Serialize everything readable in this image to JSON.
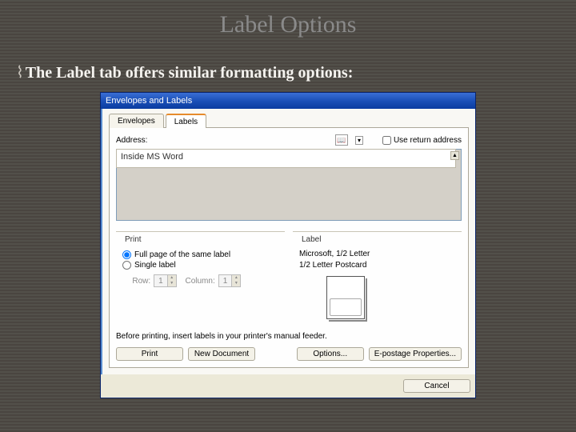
{
  "slide": {
    "title": "Label Options",
    "bullet_glyph": "⌇",
    "body": "The Label tab offers similar formatting options:"
  },
  "dialog": {
    "title": "Envelopes and Labels",
    "tabs": {
      "envelopes": "Envelopes",
      "labels": "Labels"
    },
    "address_label": "Address:",
    "book_icon_glyph": "📖",
    "dropdown_glyph": "▾",
    "use_return": "Use return address",
    "address_value": "Inside MS Word",
    "scroll_glyph": "▲",
    "print": {
      "group": "Print",
      "opt_full": "Full page of the same label",
      "opt_single": "Single label",
      "row_label": "Row:",
      "row_value": "1",
      "col_label": "Column:",
      "col_value": "1",
      "up": "▲",
      "down": "▼"
    },
    "label": {
      "group": "Label",
      "line1": "Microsoft, 1/2 Letter",
      "line2": "1/2 Letter Postcard"
    },
    "note": "Before printing, insert labels in your printer's manual feeder.",
    "buttons": {
      "print": "Print",
      "newdoc": "New Document",
      "options": "Options...",
      "epostage": "E-postage Properties...",
      "cancel": "Cancel"
    }
  }
}
